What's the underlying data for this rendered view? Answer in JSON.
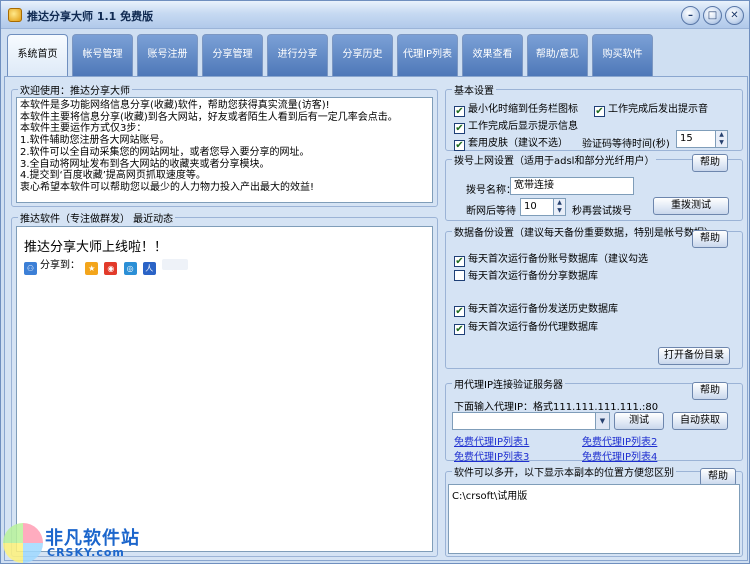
{
  "window": {
    "title": "推达分享大师 1.1 免费版"
  },
  "tabs": [
    "系统首页",
    "帐号管理",
    "账号注册",
    "分享管理",
    "进行分享",
    "分享历史",
    "代理IP列表",
    "效果查看",
    "帮助/意见",
    "购买软件"
  ],
  "welcome": {
    "title": "欢迎使用：推达分享大师",
    "lines": [
      "本软件是多功能网络信息分享(收藏)软件，帮助您获得真实流量(访客)!",
      "本软件主要将信息分享(收藏)到各大网站，好友或者陌生人看到后有一定几率会点击。",
      "本软件主要运作方式仅3步：",
      "1.软件辅助您注册各大网站账号。",
      "2.软件可以全自动采集您的网站网址，或者您导入要分享的网址。",
      "3.全自动将网址发布到各大网站的收藏夹或者分享模块。",
      "4.提交到‘百度收藏’提高网页抓取速度等。",
      "衷心希望本软件可以帮助您以最少的人力物力投入产出最大的效益!"
    ]
  },
  "news": {
    "title": "推达软件（专注做群发） 最近动态",
    "headline": "推达分享大师上线啦！！",
    "share_label": "分享到："
  },
  "basic": {
    "title": "基本设置",
    "opt_minimize": "最小化时缩到任务栏图标",
    "opt_sound": "工作完成后发出提示音",
    "opt_msg": "工作完成后显示提示信息",
    "opt_skin": "套用皮肤（建议不选）",
    "captcha_label": "验证码等待时间(秒)",
    "captcha_value": "15"
  },
  "dial": {
    "title": "拨号上网设置（适用于adsl和部分光纤用户）",
    "help": "帮助",
    "name_label": "拨号名称：",
    "name_value": "宽带连接",
    "wait_label": "断网后等待",
    "wait_value": "10",
    "retry_label": "秒再尝试拨号",
    "test": "重拨测试"
  },
  "backup": {
    "title": "数据备份设置（建议每天备份重要数据，特别是帐号数据）",
    "help": "帮助",
    "opt_account": "每天首次运行备份账号数据库（建议勾选",
    "opt_share": "每天首次运行备份分享数据库",
    "opt_history": "每天首次运行备份发送历史数据库",
    "opt_proxy": "每天首次运行备份代理数据库",
    "open": "打开备份目录"
  },
  "proxy": {
    "title": "用代理IP连接验证服务器",
    "help": "帮助",
    "input_label": "下面输入代理IP：格式111.111.111.111.:80",
    "test": "测试",
    "auto": "自动获取",
    "links": [
      "免费代理IP列表1",
      "免费代理IP列表2",
      "免费代理IP列表3",
      "免费代理IP列表4"
    ]
  },
  "multi": {
    "title": "软件可以多开，以下显示本副本的位置方便您区别",
    "help": "帮助",
    "path": "C:\\crsoft\\试用版"
  },
  "watermark": {
    "name": "非凡软件站",
    "url": "CRSKY.com"
  },
  "colors": {
    "tab_blue": "#4e78b8",
    "link": "#1f2fd0",
    "accent": "#1c66cc"
  }
}
